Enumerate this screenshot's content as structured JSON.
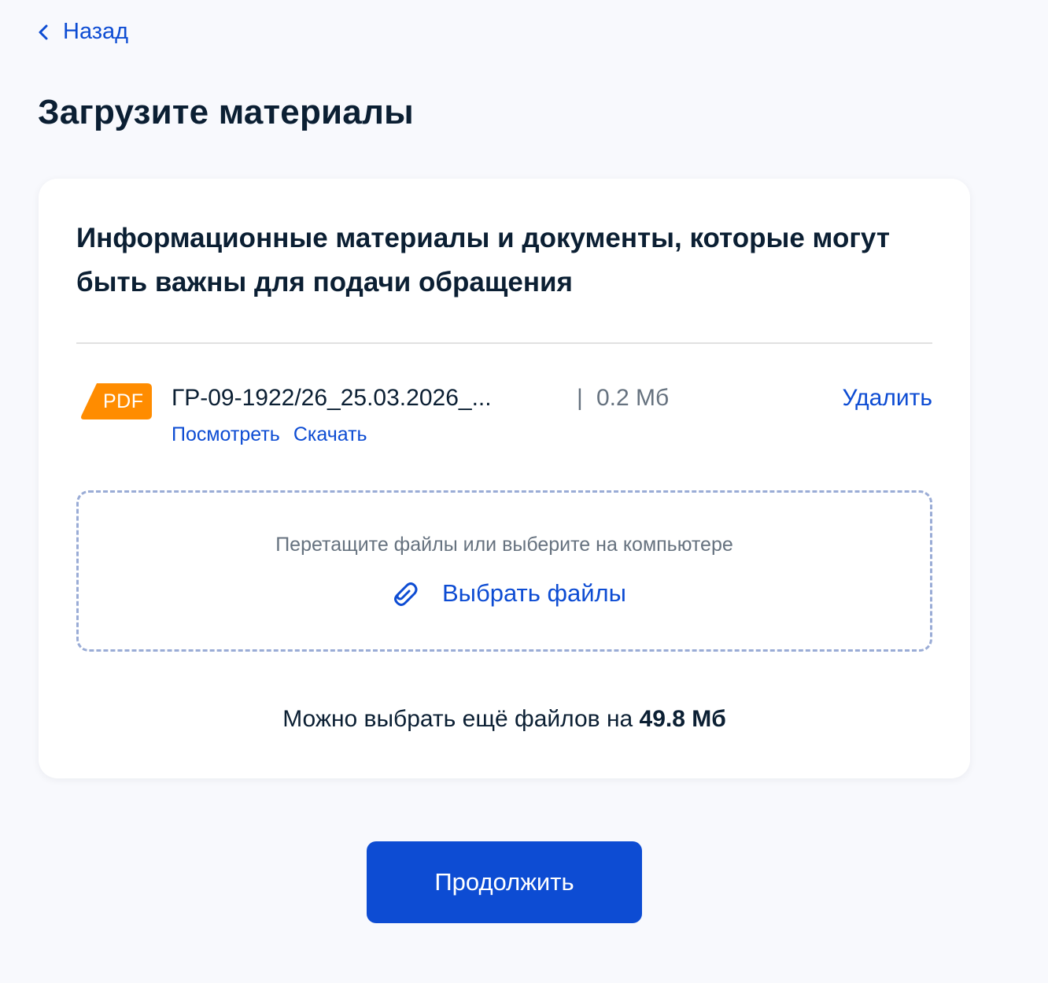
{
  "nav": {
    "back_label": "Назад"
  },
  "page": {
    "title": "Загрузите материалы"
  },
  "card": {
    "title": "Информационные материалы и документы, которые могут быть важны для подачи обращения",
    "file": {
      "type_badge": "PDF",
      "name": "ГР-09-1922/26_25.03.2026_...",
      "separator": "|",
      "size": "0.2 Мб",
      "delete_label": "Удалить",
      "view_label": "Посмотреть",
      "download_label": "Скачать"
    },
    "dropzone": {
      "hint": "Перетащите файлы или выберите на компьютере",
      "button_label": "Выбрать файлы"
    },
    "quota": {
      "prefix": "Можно выбрать ещё файлов на",
      "value": "49.8 Мб"
    }
  },
  "footer": {
    "continue_label": "Продолжить"
  },
  "colors": {
    "accent": "#0D4CD3",
    "text": "#0B1F33",
    "muted": "#66727F",
    "pdf_badge": "#FF8C00",
    "background": "#F8F9FD"
  },
  "icons": {
    "back": "chevron-left-icon",
    "file_type": "pdf-icon",
    "attach": "paperclip-icon"
  }
}
